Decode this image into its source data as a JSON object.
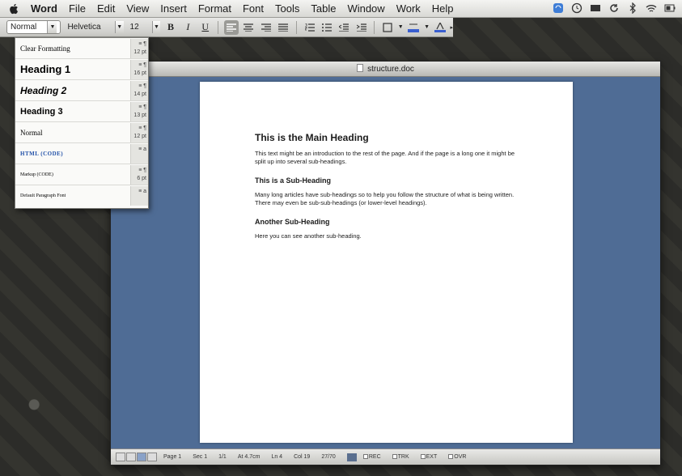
{
  "menubar": {
    "items": [
      "Word",
      "File",
      "Edit",
      "View",
      "Insert",
      "Format",
      "Font",
      "Tools",
      "Table",
      "Window",
      "Work",
      "Help"
    ],
    "status_icons": [
      "sync-icon",
      "time-machine-icon",
      "display-icon",
      "refresh-icon",
      "bluetooth-icon",
      "wifi-icon",
      "battery-icon"
    ]
  },
  "toolbar": {
    "style_value": "Normal",
    "font_value": "Helvetica",
    "size_value": "12",
    "bold_label": "B",
    "italic_label": "I",
    "underline_label": "U"
  },
  "style_menu": {
    "items": [
      {
        "label": "Clear Formatting",
        "size": "12 pt"
      },
      {
        "label": "Heading 1",
        "size": "16 pt"
      },
      {
        "label": "Heading 2",
        "size": "14 pt"
      },
      {
        "label": "Heading 3",
        "size": "13 pt"
      },
      {
        "label": "Normal",
        "size": "12 pt"
      },
      {
        "label": "HTML (CODE)",
        "size": ""
      },
      {
        "label": "Markup (CODE)",
        "size": "6 pt"
      },
      {
        "label": "Default Paragraph Font",
        "size": ""
      }
    ]
  },
  "document": {
    "filename": "structure.doc",
    "main_heading": "This is the Main Heading",
    "intro": "This text might be an introduction to the rest of the page. And if the page is a long one it might be split up into several sub-headings.",
    "sub_heading_1": "This is a Sub-Heading",
    "para_1": "Many long articles have sub-headings so to help you follow the structure of what is being written. There may even be sub-sub-headings (or lower-level headings).",
    "sub_heading_2": "Another Sub-Heading",
    "para_2": "Here you can see another sub-heading."
  },
  "statusbar": {
    "page": "Page 1",
    "section": "Sec 1",
    "page_count": "1/1",
    "position": "At 4.7cm",
    "line": "Ln 4",
    "column": "Col 19",
    "words": "27/70",
    "rec": "REC",
    "trk": "TRK",
    "ext": "EXT",
    "ovr": "OVR"
  }
}
